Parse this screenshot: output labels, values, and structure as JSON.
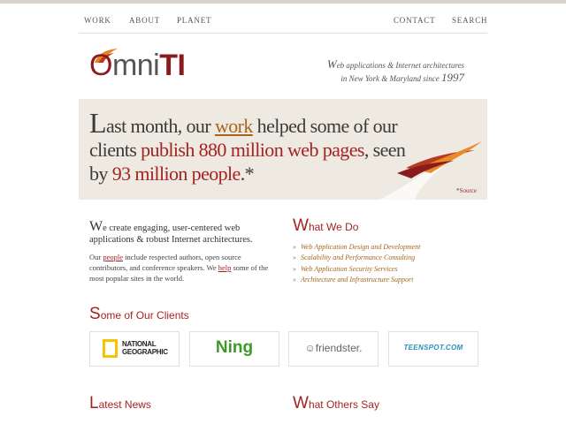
{
  "nav": {
    "left": [
      "WORK",
      "ABOUT",
      "PLANET"
    ],
    "right": [
      "CONTACT",
      "SEARCH"
    ]
  },
  "logo": {
    "o": "O",
    "mni": "mni",
    "ti": "TI"
  },
  "tagline": {
    "line1_w": "W",
    "line1_rest": "eb applications & Internet architectures",
    "line2_a": "in New York & Maryland since ",
    "line2_year": "1997"
  },
  "hero": {
    "cap": "L",
    "t1": "ast month, our ",
    "work": "work",
    "t2": " helped some of our clients ",
    "red1": "publish 880 million web pages",
    "t3": ", seen by ",
    "red2": "93 million people",
    "t4": ".*",
    "source_star": "*",
    "source": "Source"
  },
  "intro": {
    "cap": "W",
    "text": "e create engaging, user-centered web applications & robust Internet architectures."
  },
  "body": {
    "t1": "Our ",
    "link1": "people",
    "t2": " include respected authors, open source contributors, and conference speakers. We ",
    "link2": "help",
    "t3": " some of the most popular sites in the world."
  },
  "what_we_do": {
    "cap": "W",
    "rest": "hat We Do",
    "items": [
      "Web Application Design and Development",
      "Scalability and Performance Consulting",
      "Web Application Security Services",
      "Architecture and Infrastructure Support"
    ]
  },
  "clients": {
    "cap": "S",
    "rest": "ome of Our Clients",
    "natgeo_1": "NATIONAL",
    "natgeo_2": "GEOGRAPHIC",
    "ning": "Ning",
    "friendster": "☺friendster.",
    "teen": "TEENSPOT.COM"
  },
  "latest_news": {
    "cap": "L",
    "rest": "atest News"
  },
  "others_say": {
    "cap": "W",
    "rest": "hat Others Say"
  },
  "colors": {
    "accent": "#a52222",
    "orange": "#a8641a",
    "hero_bg": "#eeeae1"
  }
}
